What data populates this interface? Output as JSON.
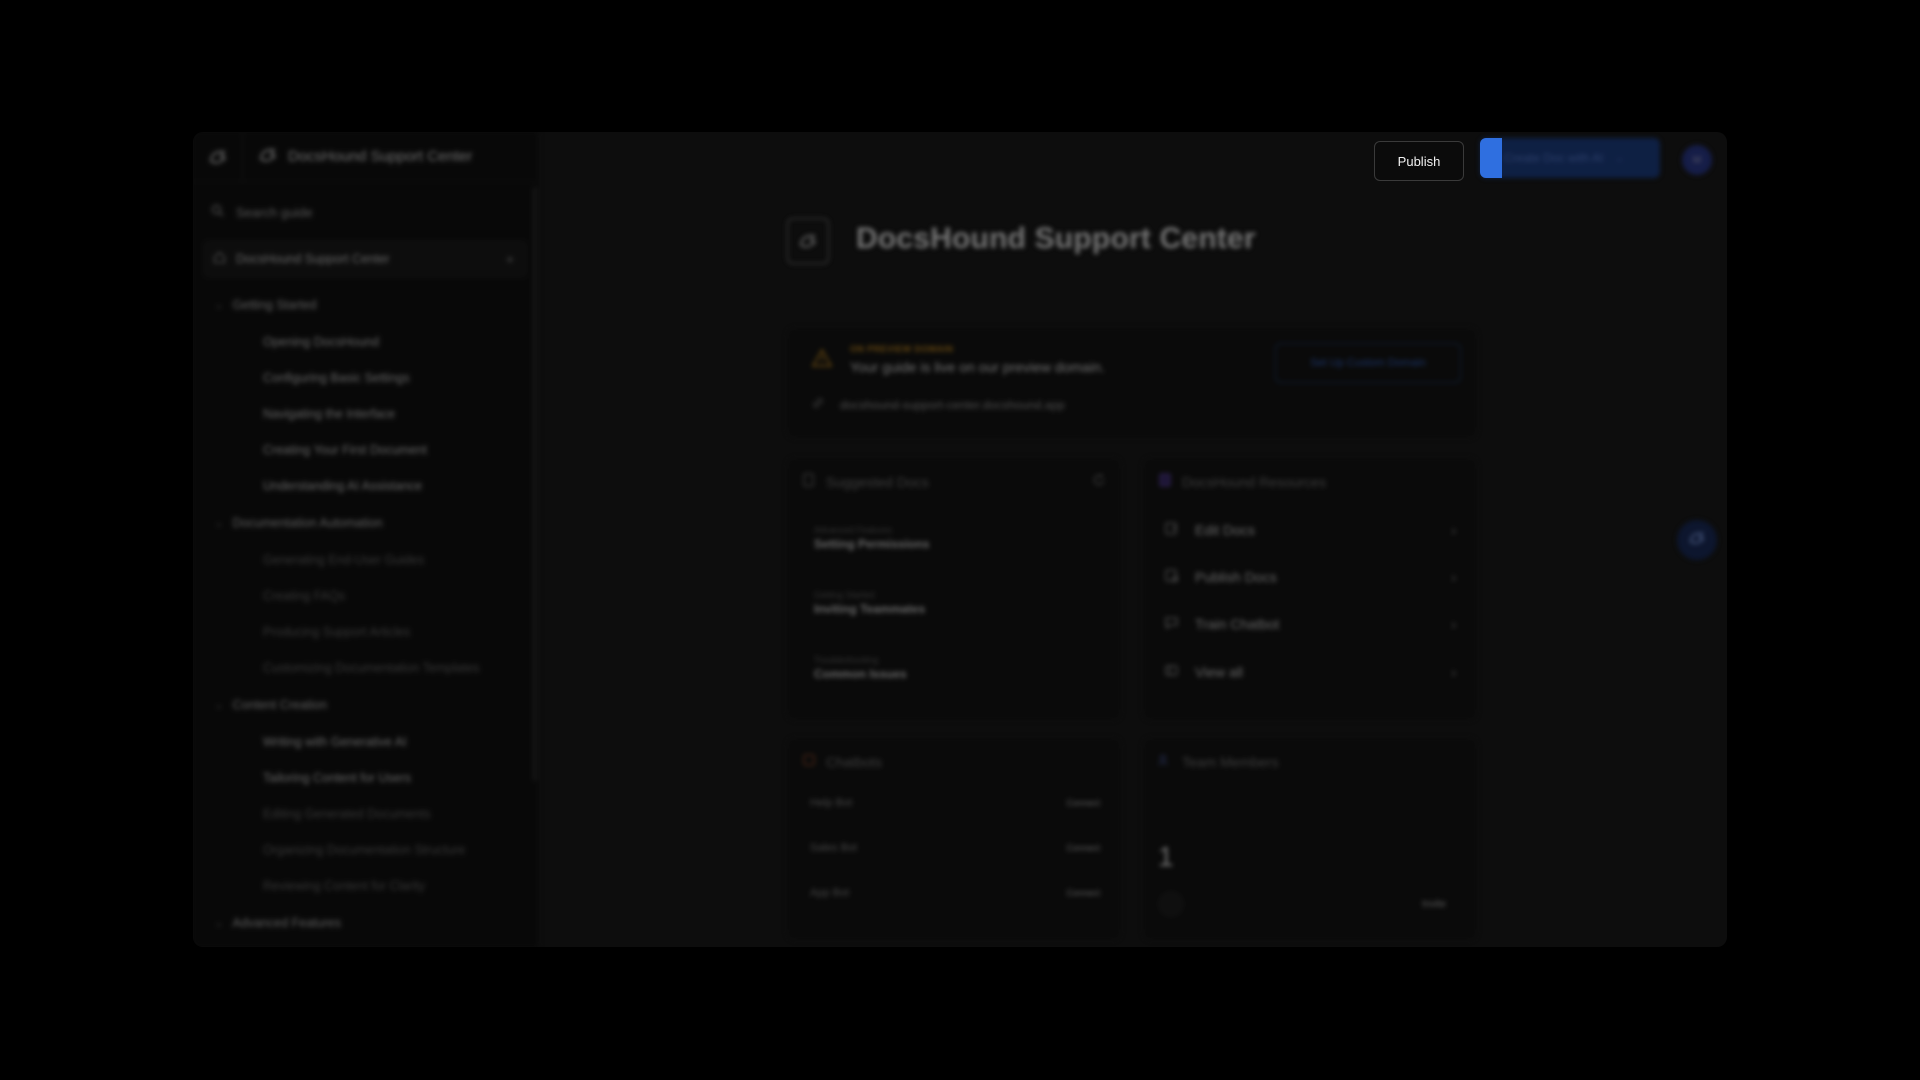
{
  "app": {
    "sidebar_title": "DocsHound Support Center",
    "search_placeholder": "Search guide",
    "home_label": "DocsHound Support Center",
    "sections": [
      {
        "label": "Getting Started",
        "items": [
          {
            "label": "Opening DocsHound"
          },
          {
            "label": "Configuring Basic Settings"
          },
          {
            "label": "Navigating the Interface"
          },
          {
            "label": "Creating Your First Document"
          },
          {
            "label": "Understanding AI Assistance"
          }
        ]
      },
      {
        "label": "Documentation Automation",
        "items": [
          {
            "label": "Generating End-User Guides"
          },
          {
            "label": "Creating FAQs"
          },
          {
            "label": "Producing Support Articles"
          },
          {
            "label": "Customizing Documentation Templates"
          }
        ]
      },
      {
        "label": "Content Creation",
        "items": [
          {
            "label": "Writing with Generative AI"
          },
          {
            "label": "Tailoring Content for Users"
          },
          {
            "label": "Editing Generated Documents"
          },
          {
            "label": "Organizing Documentation Structure"
          },
          {
            "label": "Reviewing Content for Clarity"
          }
        ]
      },
      {
        "label": "Advanced Features",
        "items": []
      }
    ]
  },
  "header": {
    "publish_label": "Publish",
    "create_label": "Create Doc with AI",
    "avatar_initials": "M"
  },
  "main": {
    "title": "DocsHound Support Center",
    "preview": {
      "tag": "ON PREVIEW DOMAIN",
      "message": "Your guide is live on our preview domain.",
      "button": "Set Up Custom Domain",
      "url": "docshound-support-center.docshound.app"
    },
    "suggested": {
      "title": "Suggested Docs",
      "items": [
        {
          "category": "Advanced Features",
          "name": "Setting Permissions"
        },
        {
          "category": "Getting Started",
          "name": "Inviting Teammates"
        },
        {
          "category": "Troubleshooting",
          "name": "Common Issues"
        }
      ]
    },
    "resources": {
      "title": "DocsHound Resources",
      "items": [
        {
          "label": "Edit Docs"
        },
        {
          "label": "Publish Docs"
        },
        {
          "label": "Train Chatbot"
        },
        {
          "label": "View all"
        }
      ]
    },
    "chatbots": {
      "title": "Chatbots",
      "items": [
        {
          "name": "Help Bot",
          "action": "Connect"
        },
        {
          "name": "Sales Bot",
          "action": "Connect"
        },
        {
          "name": "App Bot",
          "action": "Connect"
        }
      ]
    },
    "team": {
      "title": "Team Members",
      "count": "1",
      "invite": "Invite"
    }
  },
  "colors": {
    "accent": "#2f6fe0",
    "warning": "#c78a1e",
    "background": "#0d0d0d"
  }
}
